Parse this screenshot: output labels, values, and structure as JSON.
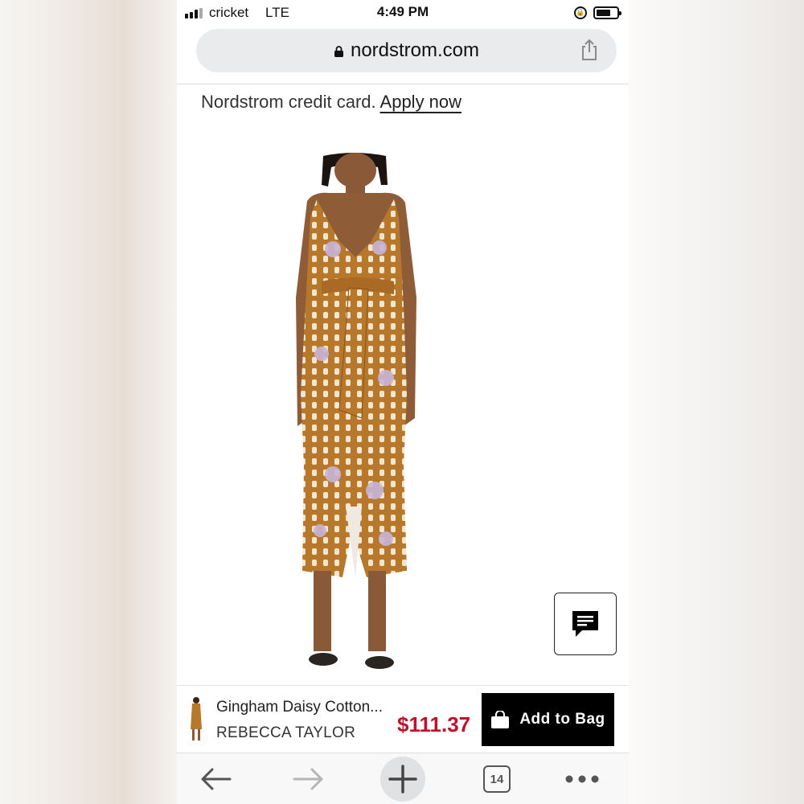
{
  "status_bar": {
    "carrier": "cricket",
    "network": "LTE",
    "time": "4:49 PM",
    "signal_icon": "signal-bars-icon",
    "battery_icon": "battery-icon"
  },
  "browser": {
    "url": "nordstrom.com",
    "lock_icon": "padlock-icon",
    "share_icon": "share-icon"
  },
  "promo": {
    "text": "Nordstrom credit card.",
    "link": "Apply now"
  },
  "product": {
    "image_alt": "model wearing mustard gingham daisy print wrap dress",
    "name": "Gingham Daisy Cotton...",
    "brand": "REBECCA TAYLOR",
    "price": "$111.37",
    "add_to_bag_label": "Add to Bag",
    "colors": {
      "price": "#c0102a",
      "dress": "#b8782c",
      "button": "#000000"
    }
  },
  "chat": {
    "icon": "chat-icon"
  },
  "toolbar": {
    "tab_count": "14",
    "icons": [
      "back-arrow-icon",
      "forward-arrow-icon",
      "plus-icon",
      "tabs-icon",
      "more-icon"
    ]
  }
}
